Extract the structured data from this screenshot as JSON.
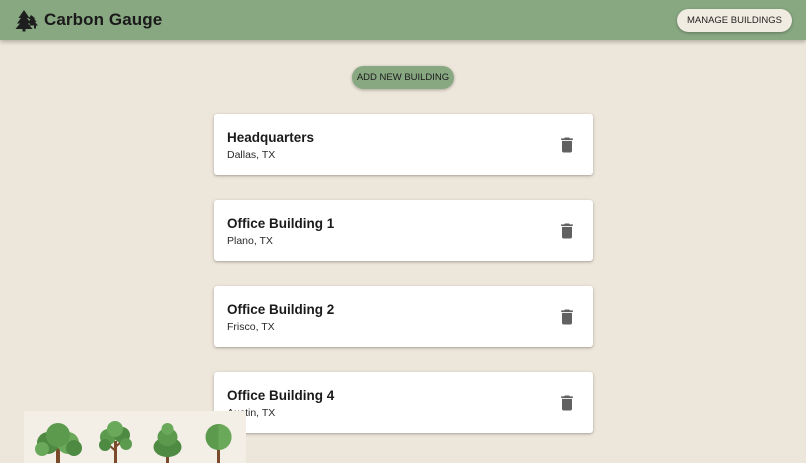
{
  "header": {
    "brand_title": "Carbon Gauge",
    "brand_icon": "pine-trees-icon",
    "manage_label": "MANAGE BUILDINGS"
  },
  "actions": {
    "add_label": "ADD NEW BUILDING"
  },
  "buildings": [
    {
      "name": "Headquarters",
      "location": "Dallas, TX"
    },
    {
      "name": "Office Building 1",
      "location": "Plano, TX"
    },
    {
      "name": "Office Building 2",
      "location": "Frisco, TX"
    },
    {
      "name": "Office Building 4",
      "location": "Austin, TX"
    }
  ],
  "colors": {
    "appbar": "#88a882",
    "background": "#ede6da",
    "card": "#ffffff",
    "tree_green": "#5c9a4e",
    "trunk": "#7a4a2a"
  }
}
